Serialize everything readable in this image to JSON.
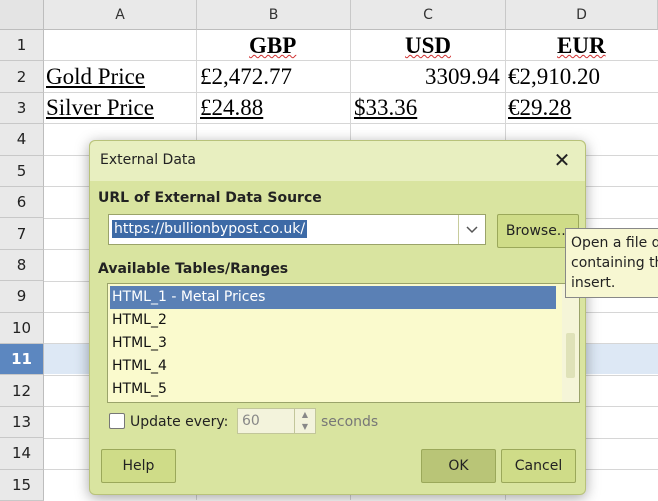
{
  "sheet": {
    "columns": [
      "A",
      "B",
      "C",
      "D"
    ],
    "rows": [
      "1",
      "2",
      "3",
      "4",
      "5",
      "6",
      "7",
      "8",
      "9",
      "10",
      "11",
      "12",
      "13",
      "14",
      "15"
    ],
    "headers": {
      "gbp": "GBP",
      "usd": "USD",
      "eur": "EUR"
    },
    "gold": {
      "label": "Gold Price",
      "gbp": "£2,472.77",
      "usd": "3309.94",
      "eur": "€2,910.20"
    },
    "silver": {
      "label": "Silver Price",
      "gbp": "£24.88",
      "usd": "$33.36",
      "eur": "€29.28"
    },
    "selected_row": "11"
  },
  "dialog": {
    "title": "External Data",
    "close_glyph": "✕",
    "url_label": "URL of External Data Source",
    "url_value": "https://bullionbypost.co.uk/",
    "browse_label": "Browse...",
    "tables_label": "Available Tables/Ranges",
    "tables": [
      "HTML_1 - Metal Prices",
      "HTML_2",
      "HTML_3",
      "HTML_4",
      "HTML_5"
    ],
    "update_label": "Update every:",
    "update_value": "60",
    "seconds_label": "seconds",
    "help_label": "Help",
    "ok_label": "OK",
    "cancel_label": "Cancel"
  },
  "tooltip": {
    "line1": "Open a file d",
    "line2": "containing th",
    "line3": "insert."
  }
}
